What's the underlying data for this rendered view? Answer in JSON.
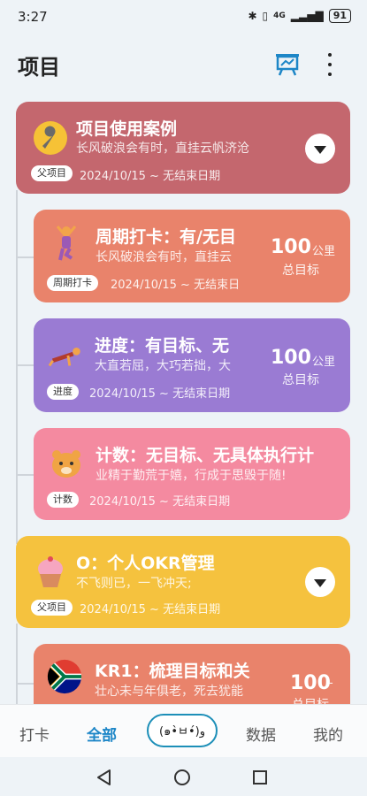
{
  "status_bar": {
    "time": "3:27",
    "network": "4G",
    "battery": "91"
  },
  "header": {
    "title": "项目",
    "chart_icon": "presentation-chart-icon",
    "more_icon": "more-vertical-icon"
  },
  "cards": [
    {
      "title": "项目使用案例",
      "subtitle": "长风破浪会有时，直挂云帆济沧",
      "tag": "父项目",
      "dates": "2024/10/15 ~ 无结束日期",
      "icon": "wrench-icon",
      "color": "#c4676e"
    },
    {
      "title": "周期打卡：有/无目",
      "subtitle": "长风破浪会有时，直挂云",
      "tag": "周期打卡",
      "dates": "2024/10/15 ~ 无结束日",
      "goal_value": "100",
      "goal_unit": "公里",
      "goal_label": "总目标",
      "icon": "yoga-icon",
      "color": "#e9836b"
    },
    {
      "title": "进度：有目标、无",
      "subtitle": "大直若屈，大巧若拙，大",
      "tag": "进度",
      "dates": "2024/10/15 ~ 无结束日期",
      "goal_value": "100",
      "goal_unit": "公里",
      "goal_label": "总目标",
      "icon": "pushup-icon",
      "color": "#9a7bd3"
    },
    {
      "title": "计数：无目标、无具体执行计",
      "subtitle": "业精于勤荒于嬉，行成于思毁于随!",
      "tag": "计数",
      "dates": "2024/10/15 ~ 无结束日期",
      "icon": "hamster-icon",
      "color": "#f48aa0"
    },
    {
      "title": "O：个人OKR管理",
      "subtitle": "不飞则已，一飞冲天;",
      "tag": "父项目",
      "dates": "2024/10/15 ~ 无结束日期",
      "icon": "cupcake-icon",
      "color": "#f5c23e"
    },
    {
      "title": "KR1：梳理目标和关",
      "subtitle": "壮心未与年俱老，死去犹能",
      "goal_value": "100",
      "goal_unit": "-",
      "goal_label": "总目标",
      "icon": "south-africa-flag-icon",
      "color": "#e9836b"
    }
  ],
  "bottom_nav": {
    "checkin": "打卡",
    "all": "全部",
    "center": "(๑•̀ㅂ•́)و",
    "stats": "数据",
    "mine": "我的"
  },
  "colors": {
    "accent": "#1d86c7",
    "background": "#eef3f7"
  }
}
